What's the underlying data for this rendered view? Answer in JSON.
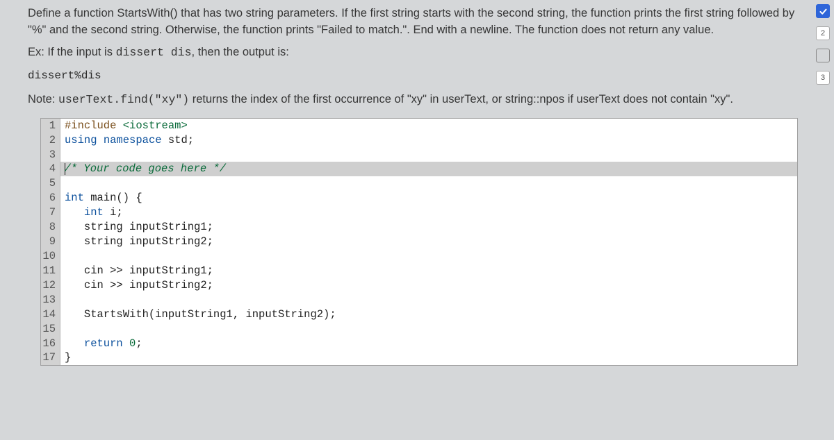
{
  "problem": {
    "desc_part1": "Define a function StartsWith() that has two string parameters. If the first string starts with the second string, the function prints the first string followed by \"%\" and the second string. Otherwise, the function prints \"Failed to match.\". End with a newline. The function does not return any value.",
    "ex_prefix": "Ex: If the input is ",
    "ex_input": "dissert dis",
    "ex_suffix": ", then the output is:",
    "ex_output": "dissert%dis",
    "note_prefix": "Note: ",
    "note_code": "userText.find(\"xy\")",
    "note_suffix": " returns the index of the first occurrence of \"xy\" in userText, or string::npos if userText does not contain \"xy\"."
  },
  "code": {
    "lines": [
      {
        "n": 1,
        "tokens": [
          [
            "kw-pre",
            "#include"
          ],
          [
            "",
            " "
          ],
          [
            "kw-str",
            "<iostream>"
          ]
        ]
      },
      {
        "n": 2,
        "tokens": [
          [
            "kw-blue",
            "using"
          ],
          [
            "",
            " "
          ],
          [
            "kw-blue",
            "namespace"
          ],
          [
            "",
            " std;"
          ]
        ]
      },
      {
        "n": 3,
        "tokens": [
          [
            "",
            ""
          ]
        ]
      },
      {
        "n": 4,
        "highlighted": true,
        "cursor": true,
        "tokens": [
          [
            "kw-cmt",
            "/* Your code goes here */"
          ]
        ]
      },
      {
        "n": 5,
        "tokens": [
          [
            "",
            ""
          ]
        ]
      },
      {
        "n": 6,
        "tokens": [
          [
            "kw-type",
            "int"
          ],
          [
            "",
            " main() {"
          ]
        ]
      },
      {
        "n": 7,
        "tokens": [
          [
            "",
            "   "
          ],
          [
            "kw-type",
            "int"
          ],
          [
            "",
            " i;"
          ]
        ]
      },
      {
        "n": 8,
        "tokens": [
          [
            "",
            "   string inputString1;"
          ]
        ]
      },
      {
        "n": 9,
        "tokens": [
          [
            "",
            "   string inputString2;"
          ]
        ]
      },
      {
        "n": 10,
        "tokens": [
          [
            "",
            ""
          ]
        ]
      },
      {
        "n": 11,
        "tokens": [
          [
            "",
            "   cin >> inputString1;"
          ]
        ]
      },
      {
        "n": 12,
        "tokens": [
          [
            "",
            "   cin >> inputString2;"
          ]
        ]
      },
      {
        "n": 13,
        "tokens": [
          [
            "",
            ""
          ]
        ]
      },
      {
        "n": 14,
        "tokens": [
          [
            "",
            "   StartsWith(inputString1, inputString2);"
          ]
        ]
      },
      {
        "n": 15,
        "tokens": [
          [
            "",
            ""
          ]
        ]
      },
      {
        "n": 16,
        "tokens": [
          [
            "",
            "   "
          ],
          [
            "kw-blue",
            "return"
          ],
          [
            "",
            " "
          ],
          [
            "kw-str",
            "0"
          ],
          [
            "",
            ";"
          ]
        ]
      },
      {
        "n": 17,
        "tokens": [
          [
            "",
            "}"
          ]
        ]
      }
    ]
  },
  "sidebar": {
    "badge2": "2",
    "badge3": "3"
  }
}
